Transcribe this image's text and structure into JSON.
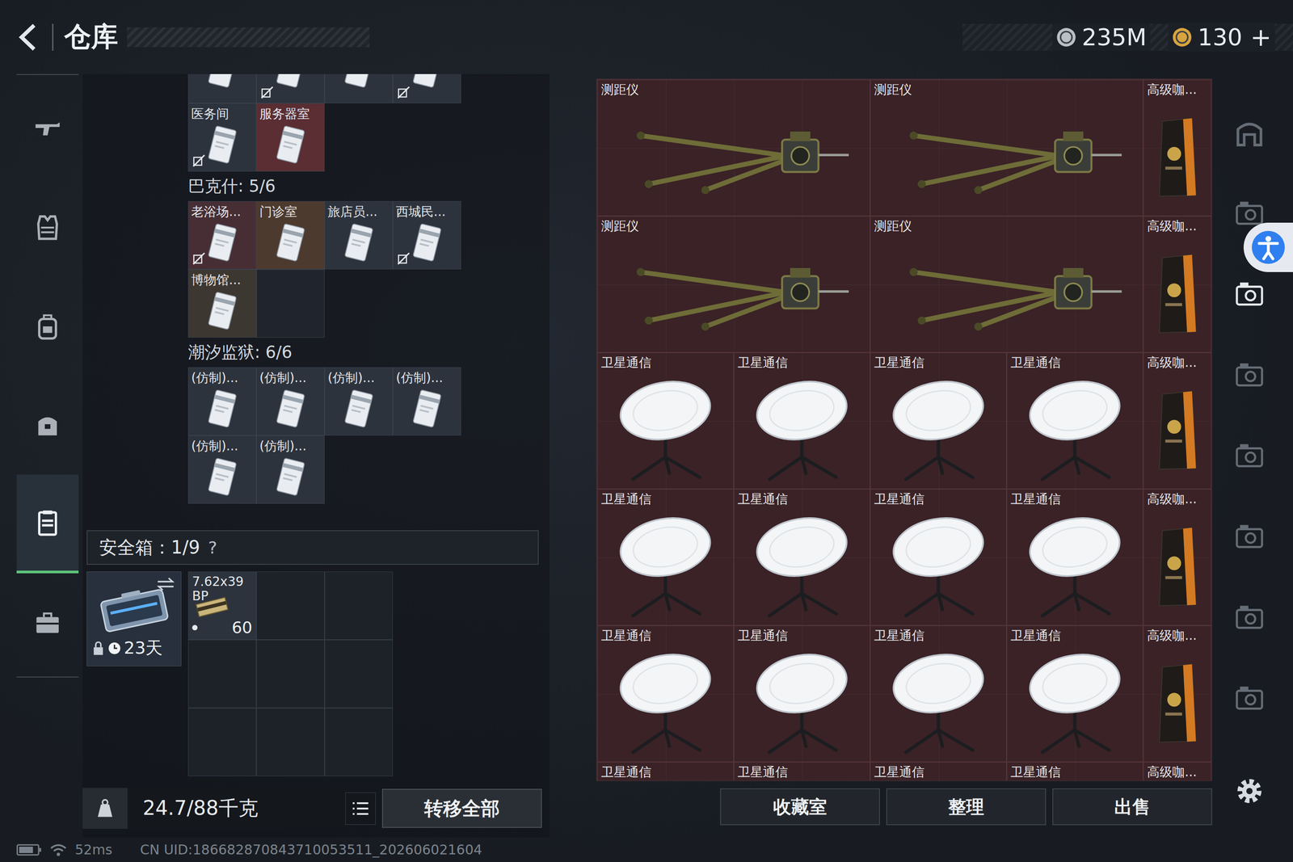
{
  "header": {
    "title": "仓库",
    "currencies": [
      {
        "amount": "235M",
        "color": "#b9bfc7"
      },
      {
        "amount": "130",
        "action": "+",
        "color": "#d8a43e"
      }
    ]
  },
  "nav": [
    {
      "selected": false
    },
    {
      "selected": false
    },
    {
      "selected": false
    },
    {
      "selected": false
    },
    {
      "selected": true
    },
    {
      "selected": false
    }
  ],
  "key_sections": [
    {
      "slots": 6,
      "cards": [
        {
          "marked": false,
          "color": "#2d333d"
        },
        {
          "marked": true,
          "color": "#2d333d"
        },
        {
          "marked": false,
          "color": "#2d333d"
        },
        {
          "marked": true,
          "color": "#2d333d"
        },
        {
          "name": "医务间",
          "marked": true,
          "color": "#2d333d"
        },
        {
          "name": "服务器室",
          "marked": false,
          "color": "#5a2e33"
        }
      ]
    },
    {
      "label": "巴克什: 5/6",
      "slots": 6,
      "cards": [
        {
          "name": "老浴场...",
          "marked": true,
          "color": "#472e34"
        },
        {
          "name": "门诊室",
          "marked": false,
          "color": "#4d3a2e"
        },
        {
          "name": "旅店员...",
          "marked": false,
          "color": "#2d333d"
        },
        {
          "name": "西城民...",
          "marked": true,
          "color": "#2d333d"
        },
        {
          "name": "博物馆...",
          "marked": false,
          "color": "#3d3731"
        }
      ]
    },
    {
      "label": "潮汐监狱: 6/6",
      "slots": 6,
      "cards": [
        {
          "name": "(仿制)...",
          "marked": false,
          "color": "#2d333d"
        },
        {
          "name": "(仿制)...",
          "marked": false,
          "color": "#2d333d"
        },
        {
          "name": "(仿制)...",
          "marked": false,
          "color": "#2d333d"
        },
        {
          "name": "(仿制)...",
          "marked": false,
          "color": "#2d333d"
        },
        {
          "name": "(仿制)...",
          "marked": false,
          "color": "#2d333d"
        },
        {
          "name": "(仿制)...",
          "marked": false,
          "color": "#2d333d"
        }
      ]
    }
  ],
  "safe_box": {
    "label": "安全箱：1/9",
    "help": "?",
    "locked": true,
    "expires": "23天",
    "slots": 9,
    "items": [
      {
        "name": "7.62x39 BP",
        "count": "60"
      }
    ]
  },
  "weight": "24.7/88千克",
  "transfer_button": "转移全部",
  "stash": {
    "items": [
      {
        "name": "测距仪",
        "kind": "rangefinder"
      },
      {
        "name": "测距仪",
        "kind": "rangefinder"
      },
      {
        "name": "高级咖...",
        "kind": "coffee"
      },
      {
        "name": "测距仪",
        "kind": "rangefinder"
      },
      {
        "name": "测距仪",
        "kind": "rangefinder"
      },
      {
        "name": "高级咖...",
        "kind": "coffee"
      },
      {
        "name": "卫星通信",
        "kind": "satellite"
      },
      {
        "name": "卫星通信",
        "kind": "satellite"
      },
      {
        "name": "卫星通信",
        "kind": "satellite"
      },
      {
        "name": "卫星通信",
        "kind": "satellite"
      },
      {
        "name": "高级咖...",
        "kind": "coffee"
      },
      {
        "name": "卫星通信",
        "kind": "satellite"
      },
      {
        "name": "卫星通信",
        "kind": "satellite"
      },
      {
        "name": "卫星通信",
        "kind": "satellite"
      },
      {
        "name": "卫星通信",
        "kind": "satellite"
      },
      {
        "name": "高级咖...",
        "kind": "coffee"
      },
      {
        "name": "卫星通信",
        "kind": "satellite"
      },
      {
        "name": "卫星通信",
        "kind": "satellite"
      },
      {
        "name": "卫星通信",
        "kind": "satellite"
      },
      {
        "name": "卫星通信",
        "kind": "satellite"
      },
      {
        "name": "高级咖...",
        "kind": "coffee"
      },
      {
        "name": "卫星通信",
        "kind": "satellite"
      },
      {
        "name": "卫星通信",
        "kind": "satellite"
      },
      {
        "name": "卫星通信",
        "kind": "satellite"
      },
      {
        "name": "卫星通信",
        "kind": "satellite"
      },
      {
        "name": "高级咖...",
        "kind": "coffee"
      }
    ]
  },
  "stash_buttons": [
    "收藏室",
    "整理",
    "出售"
  ],
  "stash_tabs": [
    {
      "selected": false
    },
    {
      "selected": false
    },
    {
      "selected": true
    },
    {
      "selected": false
    },
    {
      "selected": false
    },
    {
      "selected": false
    },
    {
      "selected": false
    },
    {
      "selected": false
    }
  ],
  "status": {
    "ping": "52ms",
    "uid": "CN UID:186682870843710053511_202606021604"
  }
}
